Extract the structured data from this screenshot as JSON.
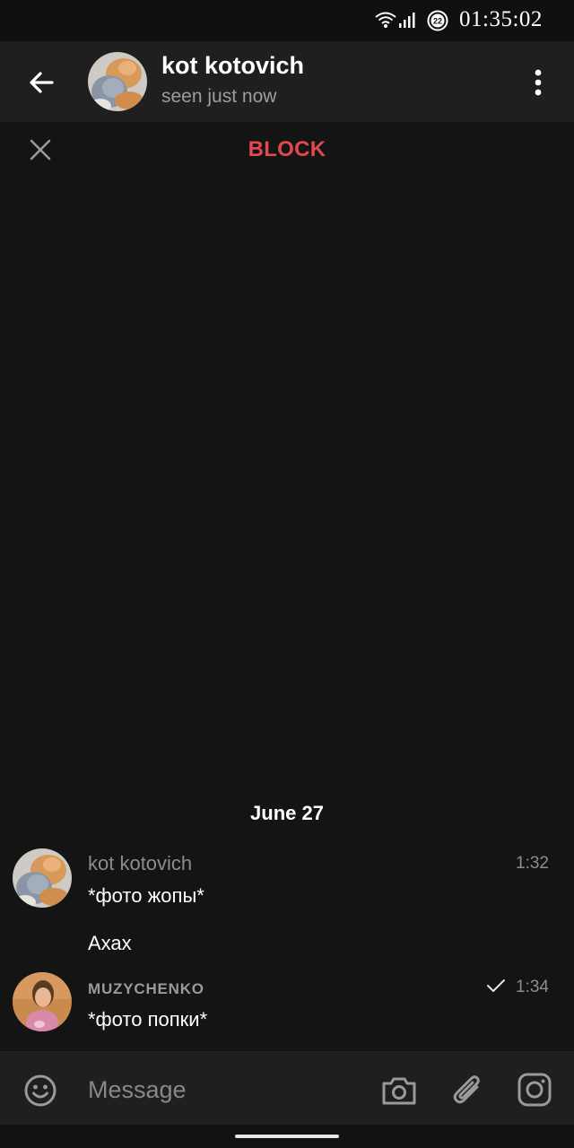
{
  "status_bar": {
    "time": "01:35:02",
    "battery_level": "22"
  },
  "header": {
    "contact_name": "kot kotovich",
    "contact_status": "seen just now"
  },
  "action_bar": {
    "block_label": "BLOCK"
  },
  "chat": {
    "date_separator": "June 27",
    "messages": [
      {
        "sender": "kot kotovich",
        "time": "1:32",
        "lines": [
          "*фото жопы*",
          "Ахах"
        ]
      },
      {
        "sender": "MUZYCHENKO",
        "time": "1:34",
        "read_status": "sent",
        "lines": [
          "*фото попки*"
        ]
      }
    ]
  },
  "input": {
    "placeholder": "Message"
  },
  "colors": {
    "background": "#141414",
    "header": "#1f1f1f",
    "block_red": "#e0494d",
    "secondary_text": "#8d8d8d"
  }
}
